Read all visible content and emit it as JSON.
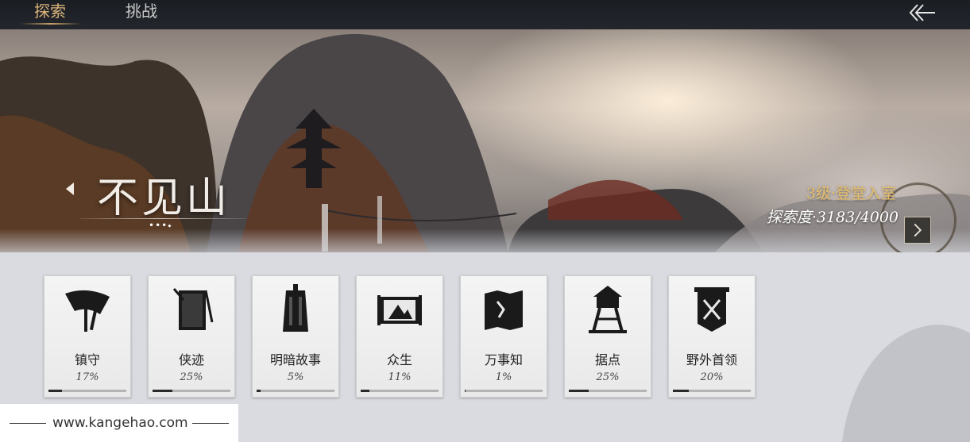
{
  "tabs": [
    {
      "label": "探索",
      "active": true
    },
    {
      "label": "挑战",
      "active": false
    }
  ],
  "region": {
    "name": "不见山",
    "level": "3级·登堂入室",
    "progress": "探索度·3183/4000",
    "dots": "•••⬩"
  },
  "categories": [
    {
      "label": "镇守",
      "pct": "17%",
      "value": 0.17,
      "icon": "umbrella-icon"
    },
    {
      "label": "侠迹",
      "pct": "25%",
      "value": 0.25,
      "icon": "scroll-book-icon"
    },
    {
      "label": "明暗故事",
      "pct": "5%",
      "value": 0.05,
      "icon": "bell-icon"
    },
    {
      "label": "众生",
      "pct": "11%",
      "value": 0.11,
      "icon": "painting-scroll-icon"
    },
    {
      "label": "万事知",
      "pct": "1%",
      "value": 0.01,
      "icon": "map-icon"
    },
    {
      "label": "据点",
      "pct": "25%",
      "value": 0.25,
      "icon": "watchtower-icon"
    },
    {
      "label": "野外首领",
      "pct": "20%",
      "value": 0.2,
      "icon": "banner-swords-icon"
    }
  ],
  "footer": {
    "watermark": "www.kangehao.com"
  },
  "colors": {
    "active_tab": "#d9b27a",
    "level_text": "#e8c06d",
    "card_bg": "#f0f0f0"
  }
}
